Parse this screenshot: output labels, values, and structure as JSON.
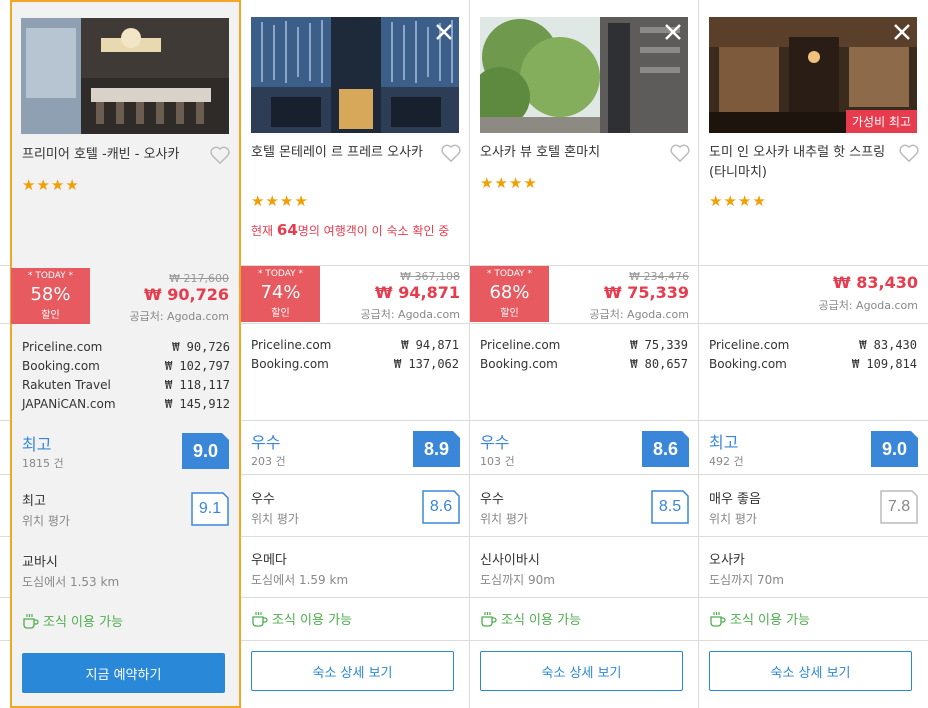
{
  "colors": {
    "accent": "#2a88d8",
    "price_red": "#e63c4e",
    "star": "#f29f05",
    "score_blue": "#3a87d9",
    "breakfast_green": "#4fae4f",
    "selected_border": "#f5a623"
  },
  "hotels": [
    {
      "name": "프리미어 호텔 -캐빈 - 오사카",
      "stars": 4,
      "stars_text": "★★★★",
      "social_proof": null,
      "today": {
        "tag": "* TODAY *",
        "percent": "58%",
        "label": "할인"
      },
      "original_price": "₩ 217,600",
      "price": "₩ 90,726",
      "supplier": "공급처: Agoda.com",
      "offers": [
        {
          "site": "Priceline.com",
          "price": "₩  90,726"
        },
        {
          "site": "Booking.com",
          "price": "₩ 102,797"
        },
        {
          "site": "Rakuten Travel",
          "price": "₩ 118,117"
        },
        {
          "site": "JAPANiCAN.com",
          "price": "₩ 145,912"
        }
      ],
      "rating_word": "최고",
      "review_count": "1815 건",
      "score": "9.0",
      "location_word": "최고",
      "location_label": "위치 평가",
      "location_score": "9.1",
      "area": "교바시",
      "distance": "도심에서 1.53 km",
      "breakfast": "조식 이용 가능",
      "button": "지금 예약하기"
    },
    {
      "name": "호텔 몬테레이 르 프레르 오사카",
      "stars": 4,
      "stars_text": "★★★★",
      "social_proof": {
        "pre": "현재 ",
        "count": "64",
        "post": "명의 여행객이 이 숙소 확인 중"
      },
      "today": {
        "tag": "* TODAY *",
        "percent": "74%",
        "label": "할인"
      },
      "original_price": "₩ 367,108",
      "price": "₩ 94,871",
      "supplier": "공급처: Agoda.com",
      "offers": [
        {
          "site": "Priceline.com",
          "price": "₩  94,871"
        },
        {
          "site": "Booking.com",
          "price": "₩ 137,062"
        }
      ],
      "rating_word": "우수",
      "review_count": "203 건",
      "score": "8.9",
      "location_word": "우수",
      "location_label": "위치 평가",
      "location_score": "8.6",
      "area": "우메다",
      "distance": "도심에서 1.59 km",
      "breakfast": "조식 이용 가능",
      "button": "숙소 상세 보기"
    },
    {
      "name": "오사카 뷰 호텔 혼마치",
      "stars": 4,
      "stars_text": "★★★★",
      "social_proof": null,
      "today": {
        "tag": "* TODAY *",
        "percent": "68%",
        "label": "할인"
      },
      "original_price": "₩ 234,476",
      "price": "₩ 75,339",
      "supplier": "공급처: Agoda.com",
      "offers": [
        {
          "site": "Priceline.com",
          "price": "₩  75,339"
        },
        {
          "site": "Booking.com",
          "price": "₩  80,657"
        }
      ],
      "rating_word": "우수",
      "review_count": "103 건",
      "score": "8.6",
      "location_word": "우수",
      "location_label": "위치 평가",
      "location_score": "8.5",
      "area": "신사이바시",
      "distance": "도심까지 90m",
      "breakfast": "조식 이용 가능",
      "button": "숙소 상세 보기"
    },
    {
      "name": "도미 인 오사카 내추럴 핫 스프링 (타니마치)",
      "stars": 4,
      "stars_text": "★★★★",
      "social_proof": null,
      "value_badge": "가성비 최고",
      "today": null,
      "original_price": null,
      "price": "₩ 83,430",
      "supplier": "공급처: Agoda.com",
      "offers": [
        {
          "site": "Priceline.com",
          "price": "₩  83,430"
        },
        {
          "site": "Booking.com",
          "price": "₩ 109,814"
        }
      ],
      "rating_word": "최고",
      "review_count": "492 건",
      "score": "9.0",
      "location_word": "매우 좋음",
      "location_label": "위치 평가",
      "location_score": "7.8",
      "area": "오사카",
      "distance": "도심까지 70m",
      "breakfast": "조식 이용 가능",
      "button": "숙소 상세 보기"
    }
  ]
}
